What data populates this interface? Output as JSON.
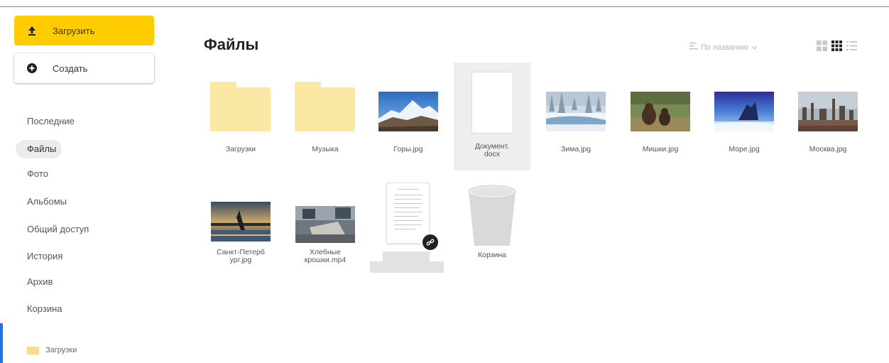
{
  "sidebar": {
    "upload_label": "Загрузить",
    "create_label": "Создать",
    "items": [
      {
        "label": "Последние"
      },
      {
        "label": "Файлы"
      },
      {
        "label": "Фото"
      },
      {
        "label": "Альбомы"
      },
      {
        "label": "Общий доступ"
      },
      {
        "label": "История"
      },
      {
        "label": "Архив"
      },
      {
        "label": "Корзина"
      }
    ],
    "active_item": "Файлы",
    "folder_label": "Загрузки"
  },
  "main": {
    "title": "Файлы",
    "sort_label": "По названию",
    "view_modes": [
      "large-tiles",
      "small-tiles",
      "list"
    ],
    "active_view": "small-tiles"
  },
  "files": [
    {
      "name": "Загрузки",
      "type": "folder"
    },
    {
      "name": "Музыка",
      "type": "folder"
    },
    {
      "name": "Горы.jpg",
      "type": "image"
    },
    {
      "name": "Документ.\ndocx",
      "type": "document"
    },
    {
      "name": "Зима.jpg",
      "type": "image"
    },
    {
      "name": "Мишки.jpg",
      "type": "image"
    },
    {
      "name": "Море.jpg",
      "type": "image"
    },
    {
      "name": "Москва.jpg",
      "type": "image"
    },
    {
      "name": "Санкт-Петерб\nург.jpg",
      "type": "image"
    },
    {
      "name": "Хлебные\nкрошки.mp4",
      "type": "video"
    },
    {
      "name": "",
      "type": "shared-document"
    },
    {
      "name": "Корзина",
      "type": "trash"
    }
  ],
  "colors": {
    "upload_button": "#ffcc00",
    "folder": "#fbe8a5",
    "selected_bg": "#eeeeee"
  }
}
